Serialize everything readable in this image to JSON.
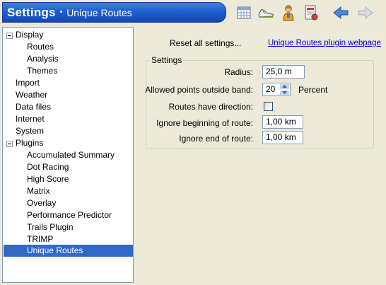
{
  "header": {
    "title": "Settings",
    "bullet": "•",
    "subtitle": "Unique Routes",
    "toolbar": [
      {
        "name": "calendar-icon"
      },
      {
        "name": "shoe-icon"
      },
      {
        "name": "athlete-icon"
      },
      {
        "name": "report-icon"
      },
      {
        "name": "back-arrow-icon"
      },
      {
        "name": "forward-arrow-icon"
      }
    ]
  },
  "tree": {
    "items": [
      {
        "label": "Display",
        "level": 0,
        "expander": true
      },
      {
        "label": "Routes",
        "level": 2
      },
      {
        "label": "Analysis",
        "level": 2
      },
      {
        "label": "Themes",
        "level": 2
      },
      {
        "label": "Import",
        "level": 1
      },
      {
        "label": "Weather",
        "level": 1
      },
      {
        "label": "Data files",
        "level": 1
      },
      {
        "label": "Internet",
        "level": 1
      },
      {
        "label": "System",
        "level": 1
      },
      {
        "label": "Plugins",
        "level": 0,
        "expander": true
      },
      {
        "label": "Accumulated Summary",
        "level": 2
      },
      {
        "label": "Dot Racing",
        "level": 2
      },
      {
        "label": "High Score",
        "level": 2
      },
      {
        "label": "Matrix",
        "level": 2
      },
      {
        "label": "Overlay",
        "level": 2
      },
      {
        "label": "Performance Predictor",
        "level": 2
      },
      {
        "label": "Trails Plugin",
        "level": 2
      },
      {
        "label": "TRIMP",
        "level": 2
      },
      {
        "label": "Unique Routes",
        "level": 2,
        "selected": true
      }
    ]
  },
  "pane": {
    "reset_label": "Reset all settings...",
    "plugin_link": "Unique Routes plugin webpage",
    "group_title": "Settings",
    "radius_label": "Radius:",
    "radius_value": "25,0 m",
    "points_label": "Allowed points outside band:",
    "points_value": "20",
    "points_unit": "Percent",
    "direction_label": "Routes have direction:",
    "direction_checked": false,
    "ignore_begin_label": "Ignore beginning of route:",
    "ignore_begin_value": "1,00 km",
    "ignore_end_label": "Ignore end of route:",
    "ignore_end_value": "1,00 km"
  },
  "colors": {
    "title_bar": "#1f5fcf",
    "selection": "#316ac5",
    "link": "#0000ee"
  }
}
